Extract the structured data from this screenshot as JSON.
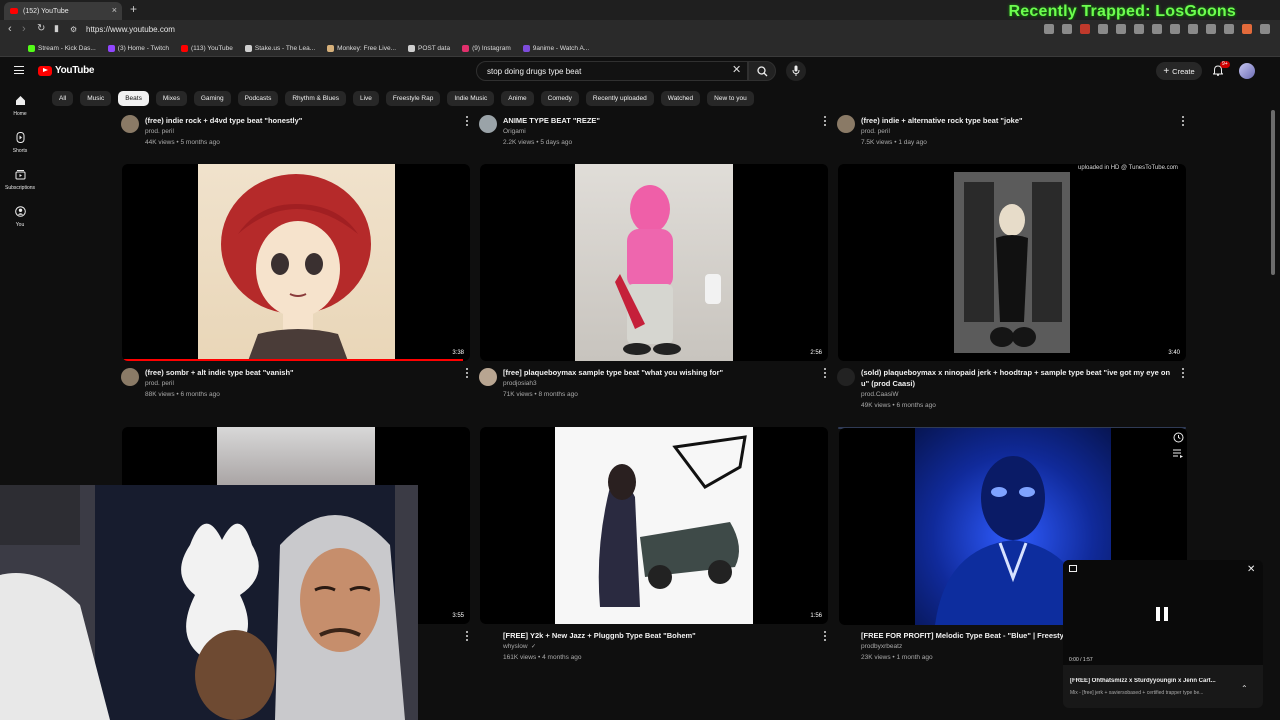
{
  "browser": {
    "tab_title": "(152) YouTube",
    "tab_close": "×",
    "new_tab": "+",
    "url": "https://www.youtube.com",
    "overlay_text": "Recently Trapped: LosGoons",
    "bookmarks": [
      {
        "label": "Stream - Kick Das...",
        "color": "#53fc18"
      },
      {
        "label": "(3) Home - Twitch",
        "color": "#9146ff"
      },
      {
        "label": "(113) YouTube",
        "color": "#ff0000"
      },
      {
        "label": "Stake.us - The Lea...",
        "color": "#cfcfcf"
      },
      {
        "label": "Monkey: Free Live...",
        "color": "#d6b07a"
      },
      {
        "label": "POST data",
        "color": "#cfcfcf"
      },
      {
        "label": "(9) Instagram",
        "color": "#e1306c"
      },
      {
        "label": "9anime - Watch A...",
        "color": "#7d4cdb"
      }
    ]
  },
  "header": {
    "logo_text": "YouTube",
    "search_value": "stop doing drugs type beat",
    "clear_symbol": "✕",
    "create_label": "Create",
    "create_plus": "+",
    "notif_badge": "9+"
  },
  "sidebar": {
    "items": [
      {
        "label": "Home"
      },
      {
        "label": "Shorts"
      },
      {
        "label": "Subscriptions"
      },
      {
        "label": "You"
      }
    ]
  },
  "chips": [
    {
      "label": "All",
      "active": false
    },
    {
      "label": "Music",
      "active": false
    },
    {
      "label": "Beats",
      "active": true
    },
    {
      "label": "Mixes",
      "active": false
    },
    {
      "label": "Gaming",
      "active": false
    },
    {
      "label": "Podcasts",
      "active": false
    },
    {
      "label": "Rhythm & Blues",
      "active": false
    },
    {
      "label": "Live",
      "active": false
    },
    {
      "label": "Freestyle Rap",
      "active": false
    },
    {
      "label": "Indie Music",
      "active": false
    },
    {
      "label": "Anime",
      "active": false
    },
    {
      "label": "Comedy",
      "active": false
    },
    {
      "label": "Recently uploaded",
      "active": false
    },
    {
      "label": "Watched",
      "active": false
    },
    {
      "label": "New to you",
      "active": false
    }
  ],
  "top_row": [
    {
      "title": "(free) indie rock + d4vd type beat \"honestly\"",
      "channel": "prod. peril",
      "meta": "44K views • 5 months ago"
    },
    {
      "title": "ANIME TYPE BEAT \"REZE\"",
      "channel": "Origami",
      "meta": "2.2K views • 5 days ago"
    },
    {
      "title": "(free) indie + alternative rock type beat \"joke\"",
      "channel": "prod. peril",
      "meta": "7.5K views • 1 day ago"
    }
  ],
  "row2": [
    {
      "title": "(free) sombr + alt indie type beat \"vanish\"",
      "channel": "prod. peril",
      "meta": "88K views • 6 months ago",
      "duration": "3:38"
    },
    {
      "title": "[free] plaqueboymax sample type beat \"what you wishing for\"",
      "channel": "prodjosiah3",
      "meta": "71K views • 8 months ago",
      "duration": "2:56"
    },
    {
      "title": "(sold) plaqueboymax x ninopaid jerk + hoodtrap + sample type beat \"ive got my eye on",
      "title2": "u\" (prod Caasi)",
      "channel": "prod.CaasiW",
      "meta": "49K views • 6 months ago",
      "duration": "3:40",
      "note": "uploaded in HD @ TunesToTube.com"
    }
  ],
  "row3": [
    {
      "duration": "3:55"
    },
    {
      "title": "[FREE] Y2k + New Jazz + Pluggnb Type Beat \"Bohem\"",
      "channel": "whyslow",
      "meta": "161K views • 4 months ago",
      "duration": "1:56"
    },
    {
      "title": "[FREE FOR PROFIT] Melodic Type Beat - \"Blue\" | Freestyle",
      "channel": "prodbyxrbeatz",
      "meta": "23K views • 1 month ago"
    }
  ],
  "miniplayer": {
    "time": "0:00 / 1:57",
    "title": "[FREE] Ohthatsmizz x Sturdyyoungin x Jenn Cart...",
    "subtitle": "Mix - [free] jerk + xaviersobased + certified trapper type be..."
  }
}
